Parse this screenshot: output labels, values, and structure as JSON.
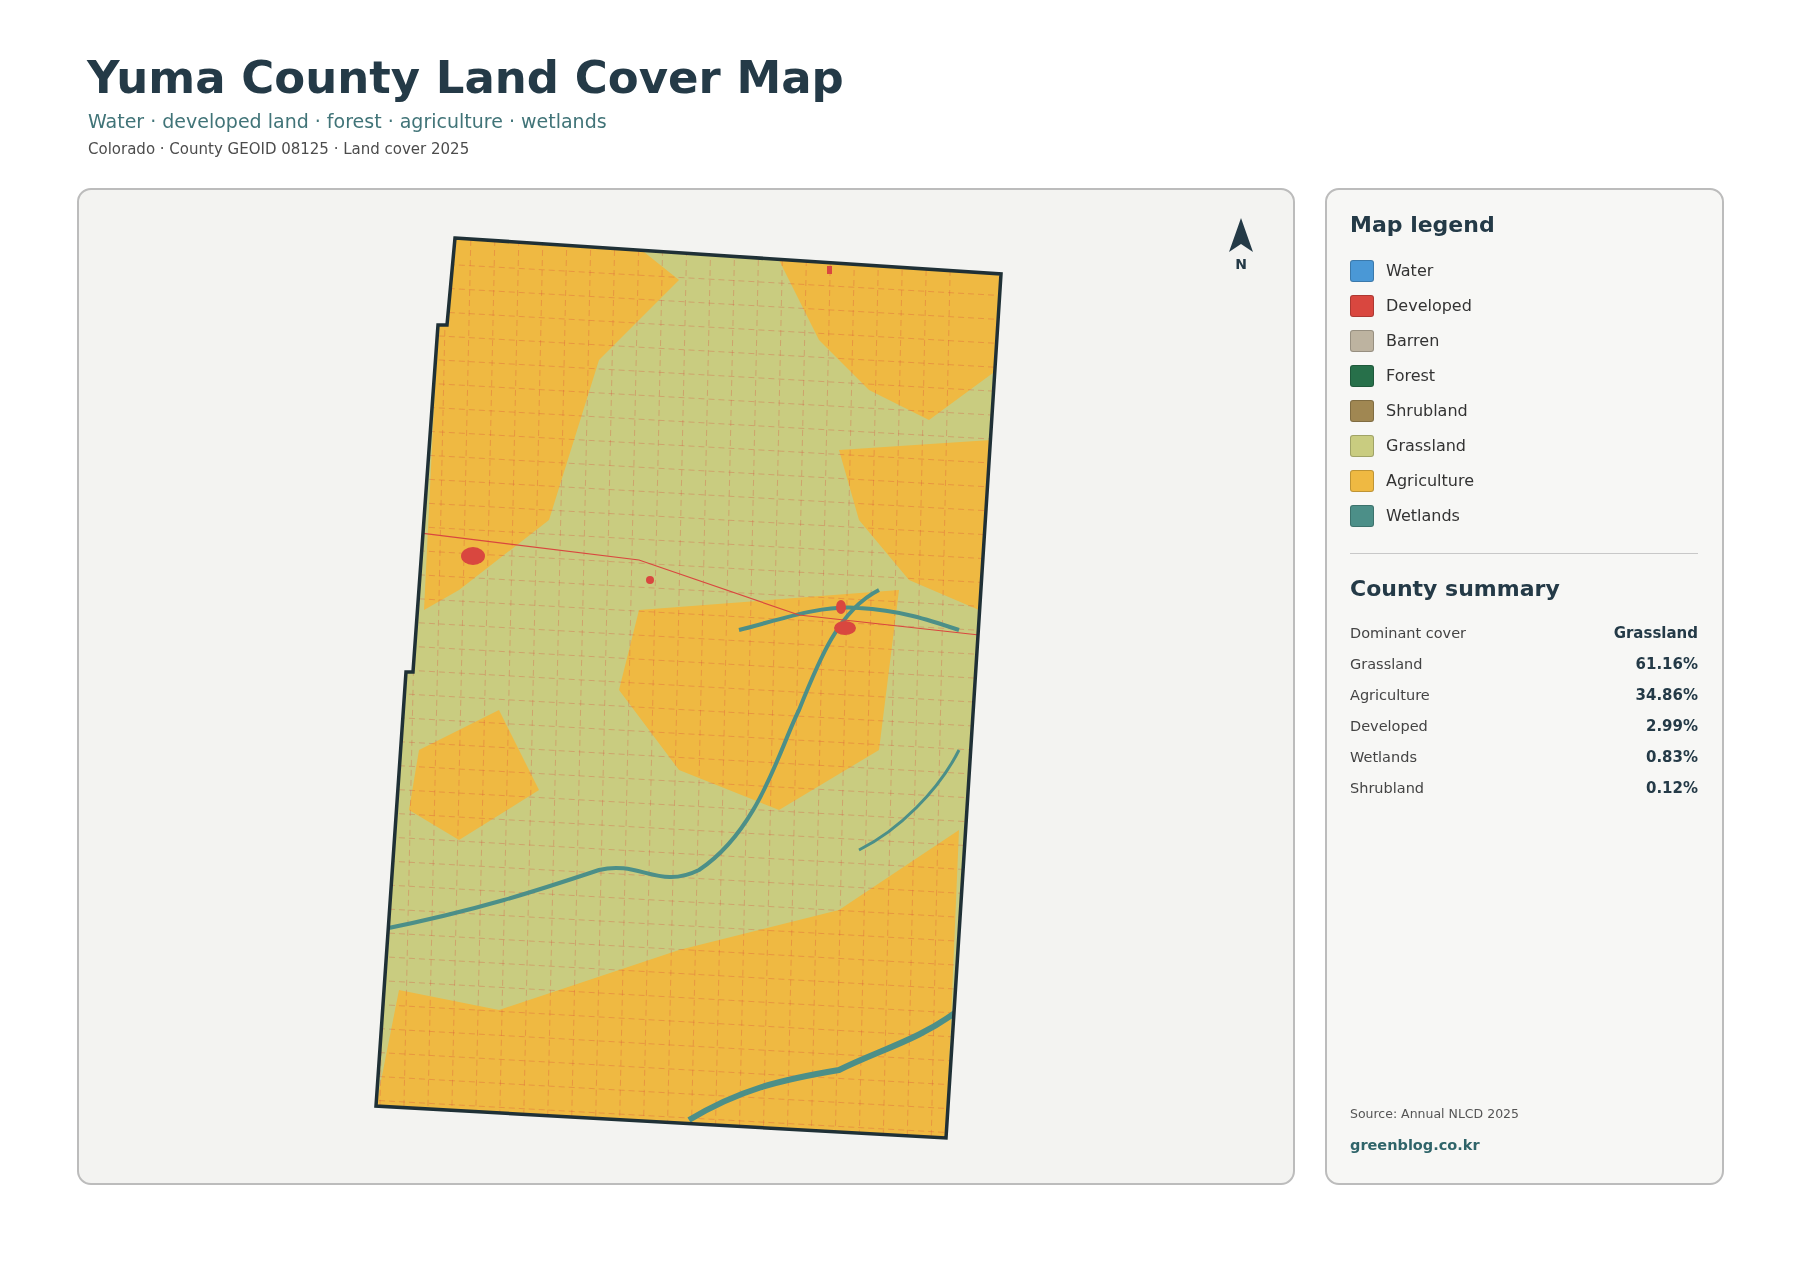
{
  "header": {
    "title": "Yuma County Land Cover Map",
    "subtitle": "Water · developed land · forest · agriculture · wetlands",
    "meta": "Colorado · County GEOID 08125 · Land cover 2025"
  },
  "map": {
    "north_label": "N"
  },
  "legend": {
    "title": "Map legend",
    "items": [
      {
        "label": "Water",
        "color": "#4a98d6"
      },
      {
        "label": "Developed",
        "color": "#d9473f"
      },
      {
        "label": "Barren",
        "color": "#bdb3a0"
      },
      {
        "label": "Forest",
        "color": "#27704a"
      },
      {
        "label": "Shrubland",
        "color": "#a08752"
      },
      {
        "label": "Grassland",
        "color": "#c9cc80"
      },
      {
        "label": "Agriculture",
        "color": "#efb942"
      },
      {
        "label": "Wetlands",
        "color": "#4c8f88"
      }
    ]
  },
  "summary": {
    "title": "County summary",
    "rows": [
      {
        "label": "Dominant cover",
        "value": "Grassland"
      },
      {
        "label": "Grassland",
        "value": "61.16%"
      },
      {
        "label": "Agriculture",
        "value": "34.86%"
      },
      {
        "label": "Developed",
        "value": "2.99%"
      },
      {
        "label": "Wetlands",
        "value": "0.83%"
      },
      {
        "label": "Shrubland",
        "value": "0.12%"
      }
    ]
  },
  "footer": {
    "source": "Source: Annual NLCD 2025",
    "site": "greenblog.co.kr"
  }
}
